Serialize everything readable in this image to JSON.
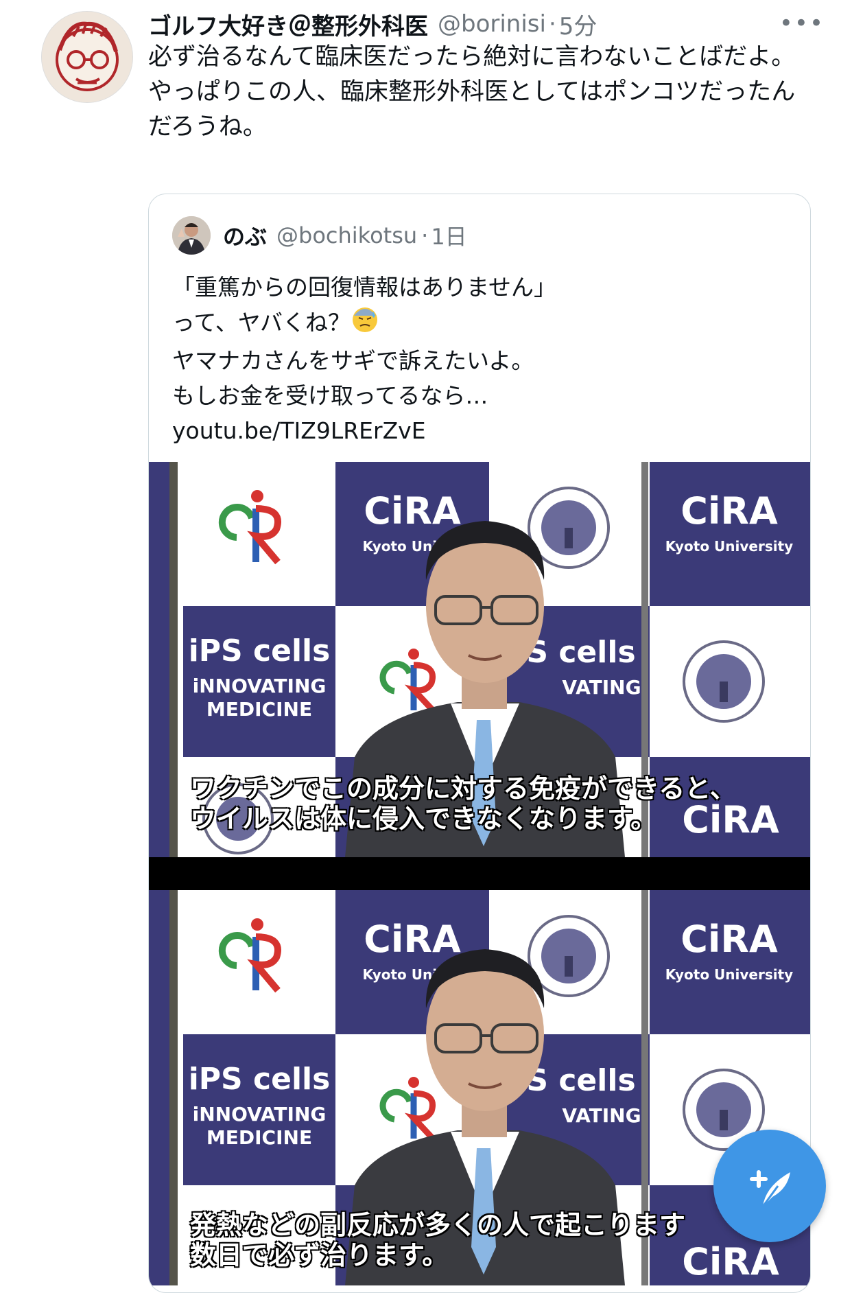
{
  "tweet": {
    "display_name": "ゴルフ大好き＠整形外科医",
    "handle": "@borinisi",
    "separator": "·",
    "time": "5分",
    "more_label": "•••",
    "text_lines": [
      "必ず治るなんて臨床医だったら絶対に言わないことばだよ。",
      "やっぱりこの人、臨床整形外科医としてはポンコツだったんだろうね。"
    ]
  },
  "quote": {
    "display_name": "のぶ",
    "handle": "@bochikotsu",
    "separator": "·",
    "time": "1日",
    "text_lines": [
      "「重篤からの回復情報はありません」",
      "って、ヤバくね？",
      "ヤマナカさんをサギで訴えたいよ。",
      "もしお金を受け取ってるなら…",
      "youtu.be/TIZ9LRErZvE"
    ],
    "emoji_icon": "downcast-face-with-sweat-icon"
  },
  "media": {
    "frames": [
      {
        "signs": {
          "cira": "CiRA",
          "kyoto_university": "Kyoto University",
          "kyoto_univer": "Kyoto Univer",
          "cira_small": "CiRA",
          "ips_cells": "iPS cells",
          "innovating": "iNNOVATING",
          "medicine": "MEDICINE",
          "s_cells": "S cells",
          "vating": "VATING"
        },
        "subtitle_lines": [
          "ワクチンでこの成分に対する免疫ができると、",
          "ウイルスは体に侵入できなくなります。"
        ]
      },
      {
        "signs": {
          "cira": "CiRA",
          "kyoto_university": "Kyoto University",
          "kyoto_univer": "Kyoto Univer",
          "cira_small": "CiRA",
          "ips_cells": "iPS cells",
          "innovating": "iNNOVATING",
          "medicine": "MEDICINE",
          "s_cells": "S cells",
          "vating": "VATING"
        },
        "subtitle_lines": [
          "発熱などの副反応が多くの人で起こります",
          "数日で必ず治ります。"
        ]
      }
    ]
  },
  "compose": {
    "icon": "compose-feather-plus-icon"
  },
  "colors": {
    "text": "#0f1419",
    "muted": "#6e767d",
    "border": "#cfd9de",
    "cira_navy": "#3b3a78",
    "compose_blue": "#3f96e6"
  }
}
